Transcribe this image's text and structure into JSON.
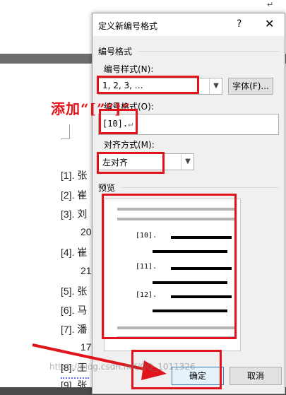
{
  "document": {
    "top_return_mark": "↵",
    "references": [
      {
        "text": "[1]. 张",
        "continued": false
      },
      {
        "text": "[2]. 崔",
        "continued": false
      },
      {
        "text": "[3]. 刘",
        "continued": false
      },
      {
        "text": "20",
        "continued": true
      },
      {
        "text": "[4]. 崔",
        "continued": false
      },
      {
        "text": "21",
        "continued": true
      },
      {
        "text": "[5]. 张",
        "continued": false
      },
      {
        "text": "[6]. 马",
        "continued": false
      },
      {
        "text": "[7]. 潘",
        "continued": false
      },
      {
        "text": "17",
        "continued": true
      },
      {
        "text": "[8]. 王",
        "continued": false
      },
      {
        "text": "[9]. 张",
        "continued": false
      }
    ]
  },
  "dialog": {
    "title": "定义新编号格式",
    "help_label": "?",
    "close_label": "✕",
    "group_number_format": "编号格式",
    "style_label": "编号样式(N):",
    "style_value": "1, 2, 3, …",
    "font_button": "字体(F)...",
    "format_label": "编号格式(O):",
    "format_value": "[10].",
    "format_cursor_mark": "↵",
    "align_label": "对齐方式(M):",
    "align_value": "左对齐",
    "preview_label": "预览",
    "preview_items": [
      "[10].",
      "[11].",
      "[12]."
    ],
    "ok_button": "确定",
    "cancel_button": "取消"
  },
  "annotation": {
    "text": "添加“[”“]”",
    "color": "#e0141a"
  },
  "watermark": "https://blog.csdn.net/QQ_1011326"
}
